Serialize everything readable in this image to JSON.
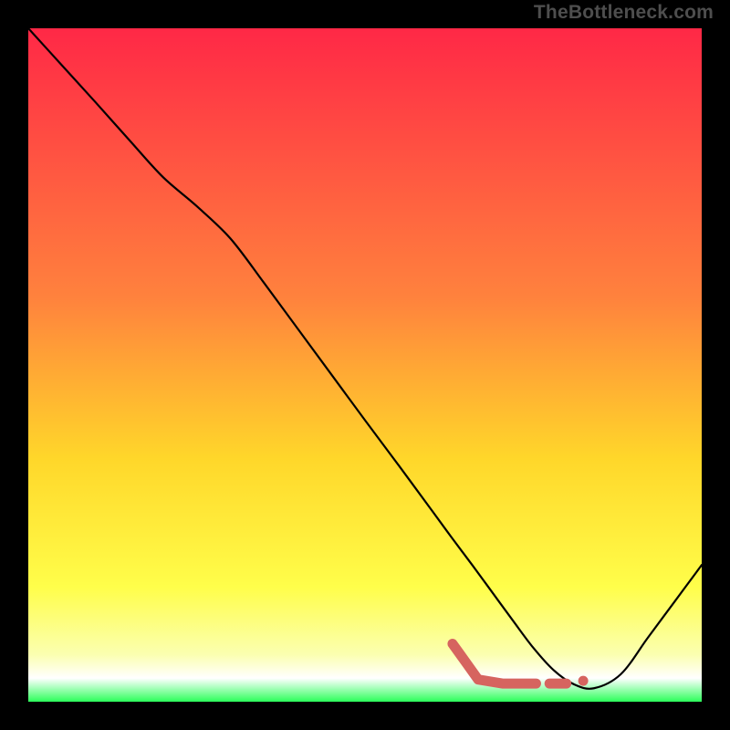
{
  "watermark": "TheBottleneck.com",
  "colors": {
    "page_bg": "#000000",
    "watermark": "#4e4e4e",
    "curve": "#000000",
    "marker_stroke": "#d6645f",
    "marker_fill": "#d6645f",
    "grad_top": "#ff2846",
    "grad_mid1": "#ff823d",
    "grad_mid2": "#ffd72a",
    "grad_mid3": "#fffe4a",
    "grad_mid4": "#fbffb0",
    "grad_bottom": "#2cff5a"
  },
  "chart_data": {
    "type": "line",
    "title": "",
    "xlabel": "",
    "ylabel": "",
    "xlim": [
      0,
      100
    ],
    "ylim": [
      0,
      100
    ],
    "grid": false,
    "legend": false,
    "series": [
      {
        "name": "bottleneck-curve",
        "x": [
          0,
          5,
          10,
          15,
          20,
          25,
          30,
          35,
          40,
          45,
          50,
          55,
          60,
          63,
          66,
          69,
          72,
          75,
          78,
          81,
          84,
          88,
          92,
          96,
          100
        ],
        "y": [
          100,
          94.5,
          89,
          83.4,
          77.9,
          73.6,
          68.8,
          62.2,
          55.4,
          48.6,
          41.8,
          35.1,
          28.3,
          24.2,
          20.2,
          16.1,
          12.0,
          8.0,
          4.7,
          2.6,
          2.0,
          4.1,
          9.5,
          14.9,
          20.3
        ]
      }
    ],
    "markers": [
      {
        "name": "highlight-path",
        "shape": "polyline",
        "x": [
          63.0,
          66.8,
          70.4,
          73.1,
          75.4
        ],
        "y": [
          8.6,
          3.3,
          2.7,
          2.7,
          2.7
        ]
      },
      {
        "name": "highlight-dash",
        "shape": "line",
        "x": [
          77.4,
          79.9
        ],
        "y": [
          2.7,
          2.7
        ]
      },
      {
        "name": "highlight-dot",
        "shape": "dot",
        "x": 82.4,
        "y": 3.1
      }
    ],
    "background_gradient": {
      "direction": "vertical",
      "stops": [
        {
          "offset": 0.0,
          "color": "#ff2846"
        },
        {
          "offset": 0.4,
          "color": "#ff823d"
        },
        {
          "offset": 0.64,
          "color": "#ffd72a"
        },
        {
          "offset": 0.83,
          "color": "#fffe4a"
        },
        {
          "offset": 0.93,
          "color": "#fbffb0"
        },
        {
          "offset": 0.965,
          "color": "#ffffff"
        },
        {
          "offset": 1.0,
          "color": "#2cff5a"
        }
      ]
    }
  }
}
